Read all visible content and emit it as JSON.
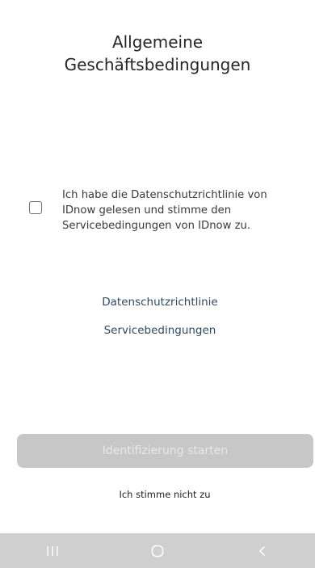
{
  "header": {
    "title_line1": "Allgemeine",
    "title_line2": "Geschäftsbedingungen"
  },
  "consent": {
    "checked": false,
    "text": "Ich habe die Datenschutzrichtlinie von IDnow gelesen und stimme den Servicebedingungen von IDnow zu."
  },
  "links": {
    "privacy": "Datenschutzrichtlinie",
    "terms": "Servicebedingungen"
  },
  "actions": {
    "start_label": "Identifizierung starten",
    "start_enabled": false,
    "decline_label": "Ich stimme nicht zu"
  },
  "navbar": {
    "icons": [
      "recent-apps-icon",
      "home-icon",
      "back-icon"
    ]
  },
  "colors": {
    "link": "#2f4a60",
    "button_disabled_bg": "#c7c7c7",
    "navbar_bg": "#cfcfcf"
  }
}
